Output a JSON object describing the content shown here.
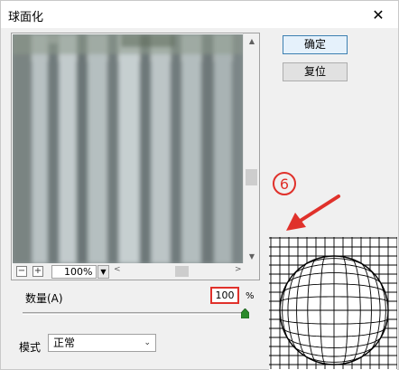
{
  "window": {
    "title": "球面化",
    "close_glyph": "✕"
  },
  "preview": {
    "zoom_minus": "−",
    "zoom_plus": "+",
    "zoom_value": "100%",
    "scroll_left_glyph": "<",
    "scroll_right_glyph": ">"
  },
  "buttons": {
    "ok": "确定",
    "reset": "复位"
  },
  "annotation": {
    "step_number": "6",
    "color": "#e0312b"
  },
  "amount": {
    "label": "数量(A)",
    "value": "100",
    "unit": "%",
    "slider_level": 1.0
  },
  "mode": {
    "label": "模式",
    "selected": "正常"
  }
}
